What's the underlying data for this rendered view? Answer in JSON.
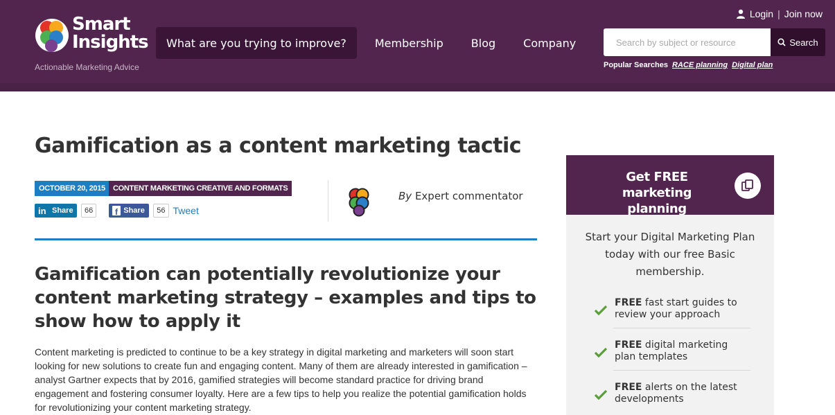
{
  "header": {
    "logo_line1": "Smart",
    "logo_line2": "Insights",
    "tagline": "Actionable Marketing Advice",
    "nav": [
      {
        "label": "What are you trying to improve?"
      },
      {
        "label": "Membership"
      },
      {
        "label": "Blog"
      },
      {
        "label": "Company"
      }
    ],
    "login_label": "Login",
    "separator": "|",
    "join_label": "Join now",
    "search": {
      "placeholder": "Search by subject or resource",
      "button_label": "Search"
    },
    "popular_label": "Popular Searches",
    "popular_links": [
      "RACE planning",
      "Digital plan"
    ]
  },
  "article": {
    "title": "Gamification as a content marketing tactic",
    "date": "OCTOBER 20, 2015",
    "category": "CONTENT MARKETING CREATIVE AND FORMATS",
    "share": {
      "linkedin_label": "Share",
      "linkedin_count": "66",
      "facebook_label": "Share",
      "facebook_count": "56",
      "tweet_label": "Tweet"
    },
    "author_prefix": "By",
    "author_name": "Expert commentator",
    "subtitle": "Gamification can potentially revolutionize your content marketing strategy – examples and tips to show how to apply it",
    "body": "Content marketing is predicted to continue to be a key strategy in digital marketing and marketers will soon start looking for new solutions to create fun and engaging content. Many of them are already interested in gamification – analyst Gartner expects that by 2016, gamified strategies will become standard practice for driving brand engagement and fostering consumer loyalty. Here are a few tips to help you realize the potential gamification holds for revolutionizing your content marketing strategy."
  },
  "sidebar": {
    "promo_title": "Get FREE marketing planning templates",
    "intro": "Start your Digital Marketing Plan today with our free Basic membership.",
    "benefits": [
      {
        "strong": "FREE",
        "text": " fast start guides to review your approach"
      },
      {
        "strong": "FREE",
        "text": " digital marketing plan templates"
      },
      {
        "strong": "FREE",
        "text": " alerts on the latest developments"
      }
    ]
  },
  "colors": {
    "brand_purple": "#52254f",
    "accent_blue": "#1d7fc1",
    "check_green": "#5a9e3a"
  }
}
